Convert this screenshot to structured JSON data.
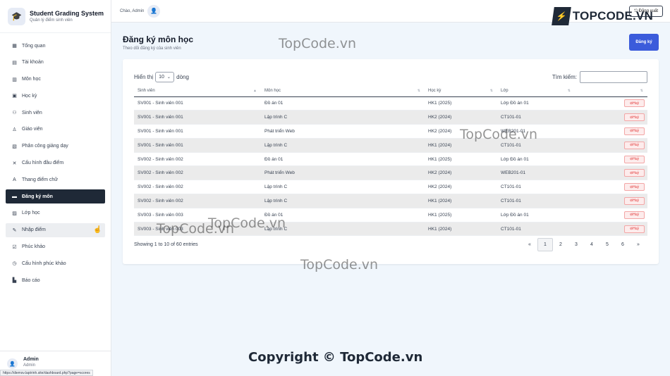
{
  "app": {
    "title": "Student Grading System",
    "subtitle": "Quản lý điểm sinh viên"
  },
  "sidebar": {
    "items": [
      {
        "label": "Tổng quan",
        "icon": "dashboard-icon"
      },
      {
        "label": "Tài khoản",
        "icon": "account-icon"
      },
      {
        "label": "Môn học",
        "icon": "book-icon"
      },
      {
        "label": "Học kỳ",
        "icon": "calendar-icon"
      },
      {
        "label": "Sinh viên",
        "icon": "students-icon"
      },
      {
        "label": "Giáo viên",
        "icon": "teacher-icon"
      },
      {
        "label": "Phân công giảng dạy",
        "icon": "assignment-icon"
      },
      {
        "label": "Cấu hình đầu điểm",
        "icon": "settings-icon"
      },
      {
        "label": "Thang điểm chữ",
        "icon": "letter-icon"
      },
      {
        "label": "Đăng ký môn",
        "icon": "register-icon"
      },
      {
        "label": "Lớp học",
        "icon": "class-icon"
      },
      {
        "label": "Nhập điểm",
        "icon": "edit-icon"
      },
      {
        "label": "Phúc khảo",
        "icon": "review-icon"
      },
      {
        "label": "Cấu hình phúc khảo",
        "icon": "timer-icon"
      },
      {
        "label": "Báo cáo",
        "icon": "report-icon"
      }
    ],
    "active_index": 9
  },
  "user": {
    "name": "Admin",
    "role": "Admin"
  },
  "status_url": "https://diemsv.laptrinh.site/dashboard.php?page=scores",
  "topbar": {
    "greeting": "Chào, Admin",
    "logout_label": "Đăng xuất",
    "brand_mark": "TOPCODE.VN"
  },
  "page": {
    "title": "Đăng ký môn học",
    "subtitle": "Theo dõi đăng ký của sinh viên",
    "register_button": "Đăng ký"
  },
  "table_controls": {
    "show_prefix": "Hiển thị",
    "page_length": "10",
    "show_suffix": "dòng",
    "search_label": "Tìm kiếm:"
  },
  "table": {
    "columns": [
      "Sinh viên",
      "Môn học",
      "Học kỳ",
      "Lớp",
      ""
    ],
    "action_label": "Huỷ",
    "rows": [
      {
        "student": "SV001 - Sinh viên 001",
        "subject": "Đồ án 01",
        "term": "HK1 (2025)",
        "class": "Lớp Đồ án 01"
      },
      {
        "student": "SV001 - Sinh viên 001",
        "subject": "Lập trình C",
        "term": "HK2 (2024)",
        "class": "CT101-01"
      },
      {
        "student": "SV001 - Sinh viên 001",
        "subject": "Phát triển Web",
        "term": "HK2 (2024)",
        "class": "WEB201-01"
      },
      {
        "student": "SV001 - Sinh viên 001",
        "subject": "Lập trình C",
        "term": "HK1 (2024)",
        "class": "CT101-01"
      },
      {
        "student": "SV002 - Sinh viên 002",
        "subject": "Đồ án 01",
        "term": "HK1 (2025)",
        "class": "Lớp Đồ án 01"
      },
      {
        "student": "SV002 - Sinh viên 002",
        "subject": "Phát triển Web",
        "term": "HK2 (2024)",
        "class": "WEB201-01"
      },
      {
        "student": "SV002 - Sinh viên 002",
        "subject": "Lập trình C",
        "term": "HK2 (2024)",
        "class": "CT101-01"
      },
      {
        "student": "SV002 - Sinh viên 002",
        "subject": "Lập trình C",
        "term": "HK1 (2024)",
        "class": "CT101-01"
      },
      {
        "student": "SV003 - Sinh viên 003",
        "subject": "Đồ án 01",
        "term": "HK1 (2025)",
        "class": "Lớp Đồ án 01"
      },
      {
        "student": "SV003 - Sinh viên 003",
        "subject": "Lập trình C",
        "term": "HK1 (2024)",
        "class": "CT101-01"
      }
    ]
  },
  "pagination": {
    "info": "Showing 1 to 10 of 60 entries",
    "prev": "«",
    "pages": [
      "1",
      "2",
      "3",
      "4",
      "5",
      "6"
    ],
    "next": "»",
    "current": "1"
  },
  "watermarks": {
    "topcode": "TopCode.vn",
    "copyright": "Copyright © TopCode.vn"
  }
}
